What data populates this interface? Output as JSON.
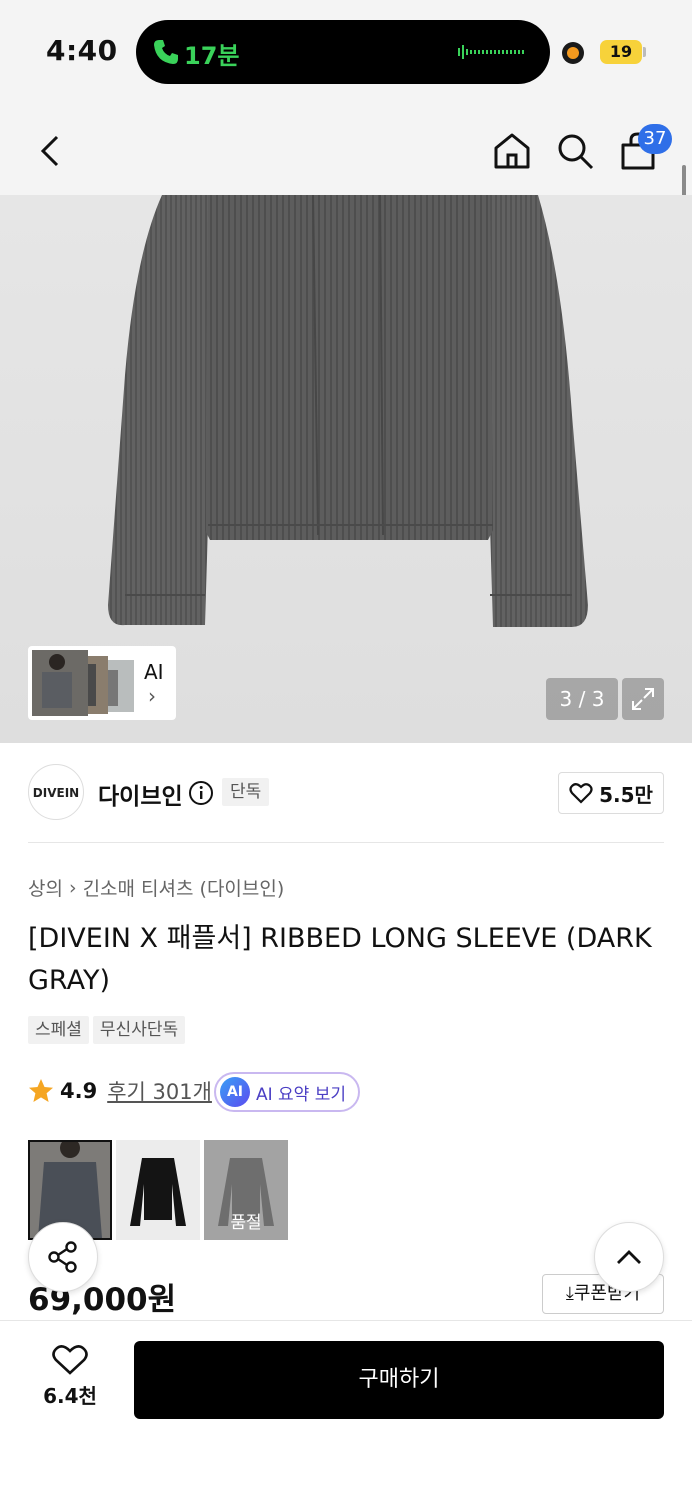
{
  "status_bar": {
    "time": "4:40",
    "call_duration": "17분",
    "battery": "19"
  },
  "header": {
    "cart_count": "37",
    "icons": [
      "back-icon",
      "home-icon",
      "search-icon",
      "cart-icon"
    ]
  },
  "gallery": {
    "ai_label": "AI",
    "counter": "3 / 3"
  },
  "brand": {
    "logo_text": "DIVEIN",
    "name": "다이브인",
    "exclusive_tag": "단독",
    "likes": "5.5만"
  },
  "product": {
    "breadcrumb": [
      "상의",
      "긴소매 티셔츠 (다이브인)"
    ],
    "title": "[DIVEIN X 패플서] RIBBED LONG SLEEVE (DARK GRAY)",
    "tags": [
      "스페셜",
      "무신사단독"
    ],
    "rating": "4.9",
    "reviews_label": "후기 301개",
    "ai_summary_badge": "AI",
    "ai_summary_label": "AI 요약 보기",
    "color_options": [
      {
        "name": "dark-gray",
        "selected": true,
        "sold_out": false
      },
      {
        "name": "black",
        "selected": false,
        "sold_out": false
      },
      {
        "name": "gray",
        "selected": false,
        "sold_out": true
      }
    ],
    "sold_out_label": "품절",
    "price": "69,000원",
    "coupon_label": "쿠폰받기"
  },
  "bottom_bar": {
    "wish_count": "6.4천",
    "buy_label": "구매하기"
  },
  "colors": {
    "accent_blue": "#2f6fe8",
    "call_green": "#3ad25a",
    "star": "#f5a623",
    "ai_purple": "#4b3fc4"
  }
}
